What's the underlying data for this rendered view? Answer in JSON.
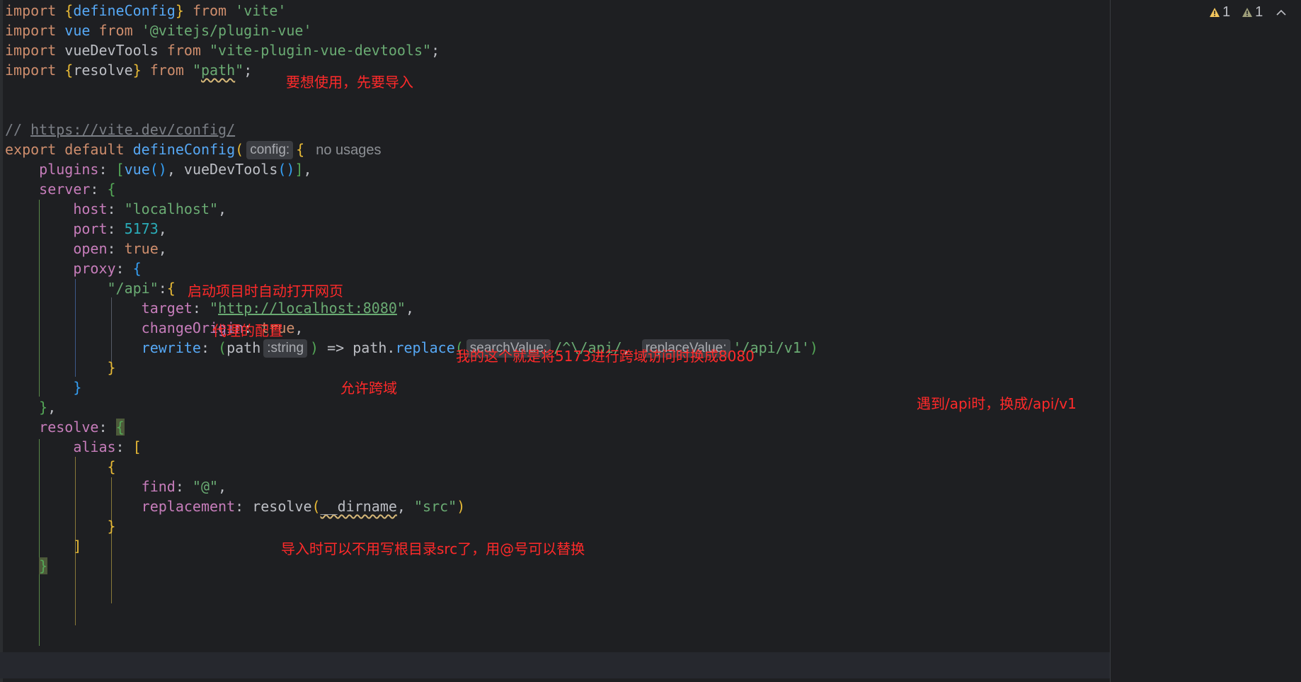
{
  "code": {
    "l1": {
      "kw1": "import",
      "sp1": " ",
      "br_open": "{",
      "name": "defineConfig",
      "br_close": "}",
      "sp2": " ",
      "kw2": "from",
      "sp3": " ",
      "src": "'vite'"
    },
    "l2": {
      "kw1": "import",
      "sp1": " ",
      "name": "vue",
      "sp2": " ",
      "kw2": "from",
      "sp3": " ",
      "src": "'@vitejs/plugin-vue'"
    },
    "l3": {
      "kw1": "import",
      "sp1": " ",
      "name": "vueDevTools",
      "sp2": " ",
      "kw2": "from",
      "sp3": " ",
      "src": "\"vite-plugin-vue-devtools\"",
      "end": ";"
    },
    "l4": {
      "kw1": "import",
      "sp1": " ",
      "br_open": "{",
      "name": "resolve",
      "br_close": "}",
      "sp2": " ",
      "kw2": "from",
      "sp3": " ",
      "q1": "\"",
      "src": "path",
      "q2": "\"",
      "end": ";"
    },
    "l7": {
      "comment": "// ",
      "link": "https://vite.dev/config/"
    },
    "l8": {
      "kw1": "export",
      "sp1": " ",
      "kw2": "default",
      "sp2": " ",
      "fn": "defineConfig",
      "paren": "(",
      "hint": "config:",
      "brace": "{",
      "usages": "no usages"
    },
    "l9": {
      "indent": "    ",
      "prop": "plugins",
      "colon": ": ",
      "bo": "[",
      "f1": "vue",
      "p1": "()",
      "comma": ", ",
      "f2": "vueDevTools",
      "p2": "()",
      "bc": "]",
      "end": ","
    },
    "l10": {
      "indent": "    ",
      "prop": "server",
      "colon": ": ",
      "brace": "{"
    },
    "l11": {
      "indent": "        ",
      "prop": "host",
      "colon": ": ",
      "val": "\"localhost\"",
      "end": ","
    },
    "l12": {
      "indent": "        ",
      "prop": "port",
      "colon": ": ",
      "val": "5173",
      "end": ","
    },
    "l13": {
      "indent": "        ",
      "prop": "open",
      "colon": ": ",
      "val": "true",
      "end": ","
    },
    "l14": {
      "indent": "        ",
      "prop": "proxy",
      "colon": ": ",
      "brace": "{"
    },
    "l15": {
      "indent": "            ",
      "key": "\"/api\"",
      "colon": ":",
      "brace": "{"
    },
    "l16": {
      "indent": "                ",
      "prop": "target",
      "colon": ": ",
      "q1": "\"",
      "val": "http://localhost:8080",
      "q2": "\"",
      "end": ","
    },
    "l17": {
      "indent": "                ",
      "prop": "changeOrigin",
      "colon": ": ",
      "val": "true",
      "end": ","
    },
    "l18": {
      "indent": "                ",
      "prop": "rewrite",
      "colon": ": ",
      "po": "(",
      "param": "path",
      "hint_type": ":string",
      "pc": ")",
      "arrow": " => ",
      "obj": "path.",
      "method": "replace",
      "mo": "(",
      "hint1": "searchValue:",
      "regex": "/^\\/api/",
      "comma": ", ",
      "hint2": "replaceValue:",
      "repl": "'/api/v1'",
      "mc": ")"
    },
    "l19": {
      "indent": "            ",
      "brace": "}"
    },
    "l20": {
      "indent": "        ",
      "brace": "}"
    },
    "l21": {
      "indent": "    ",
      "brace": "}",
      "end": ","
    },
    "l22": {
      "indent": "    ",
      "prop": "resolve",
      "colon": ": ",
      "brace": "{"
    },
    "l23": {
      "indent": "        ",
      "prop": "alias",
      "colon": ": ",
      "bo": "["
    },
    "l24": {
      "indent": "            ",
      "brace": "{"
    },
    "l25": {
      "indent": "                ",
      "prop": "find",
      "colon": ": ",
      "val": "\"@\"",
      "end": ","
    },
    "l26": {
      "indent": "                ",
      "prop": "replacement",
      "colon": ": ",
      "fn": "resolve",
      "po": "(",
      "arg": "__dirname",
      "comma": ", ",
      "val": "\"src\"",
      "pc": ")"
    },
    "l27": {
      "indent": "            ",
      "brace": "}"
    },
    "l28": {
      "indent": "        ",
      "bc": "]"
    },
    "l29": {
      "indent": "    ",
      "brace": "}"
    }
  },
  "annotations": {
    "import_note": "要想使用，先要导入",
    "open_note": "启动项目时自动打开网页",
    "proxy_note": "代理的配置",
    "target_note": "我的这个就是将5173进行跨域访问时换成8080",
    "change_origin_note": "允许跨域",
    "rewrite_note": "遇到/api时，换成/api/v1",
    "alias_note": "导入时可以不用写根目录src了，用@号可以替换"
  },
  "inspections": {
    "warning_count_1": "1",
    "warning_count_2": "1",
    "warning_icon": "warning-triangle-icon",
    "weak_warning_icon": "weak-warning-triangle-icon",
    "chevron_icon": "chevron-up-icon",
    "warning_color": "#f2c55c",
    "weak_warning_color": "#9e9e7a"
  },
  "colors": {
    "background": "#1e1f22",
    "keyword": "#cf8e6d",
    "string": "#6aab73",
    "number": "#2aacb8",
    "function": "#56a8f5",
    "property": "#c77dbb",
    "annotation": "#ff2a2a"
  }
}
